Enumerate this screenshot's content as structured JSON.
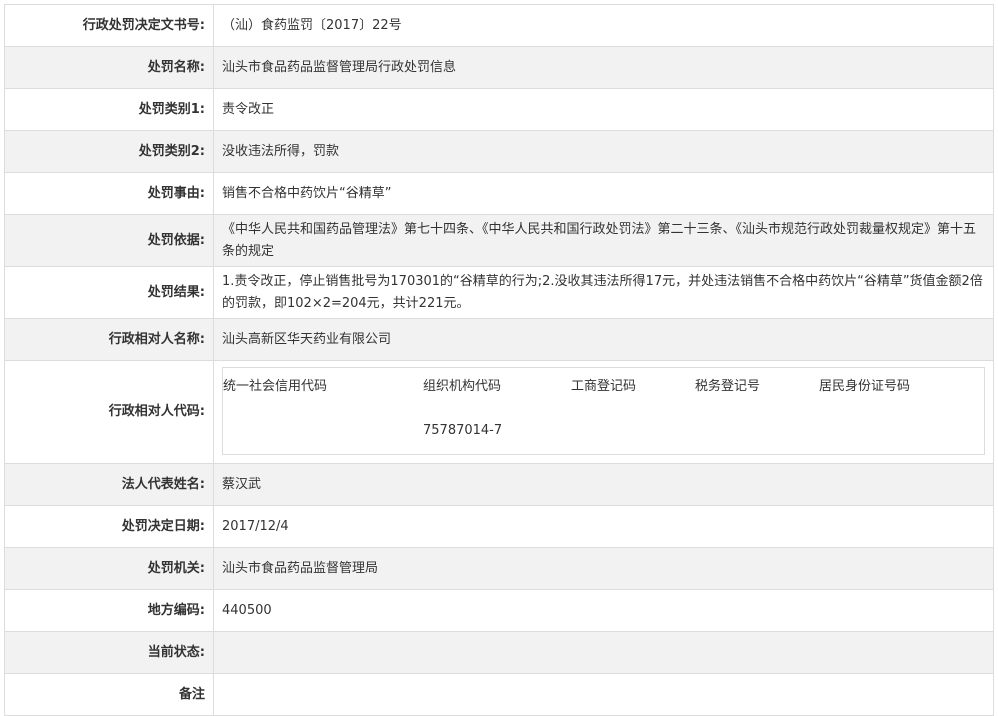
{
  "rows": [
    {
      "label": "行政处罚决定文书号:",
      "value": "（汕）食药监罚〔2017〕22号"
    },
    {
      "label": "处罚名称:",
      "value": "汕头市食品药品监督管理局行政处罚信息"
    },
    {
      "label": "处罚类别1:",
      "value": "责令改正"
    },
    {
      "label": "处罚类别2:",
      "value": "没收违法所得，罚款"
    },
    {
      "label": "处罚事由:",
      "value": "销售不合格中药饮片“谷精草”"
    },
    {
      "label": "处罚依据:",
      "value": "《中华人民共和国药品管理法》第七十四条、《中华人民共和国行政处罚法》第二十三条、《汕头市规范行政处罚裁量权规定》第十五条的规定"
    },
    {
      "label": "处罚结果:",
      "value": "1.责令改正，停止销售批号为170301的“谷精草的行为;2.没收其违法所得17元，并处违法销售不合格中药饮片“谷精草”货值金额2倍的罚款，即102×2=204元，共计221元。"
    },
    {
      "label": "行政相对人名称:",
      "value": "汕头高新区华天药业有限公司"
    }
  ],
  "code_row": {
    "label": "行政相对人代码:",
    "headers": [
      "统一社会信用代码",
      "组织机构代码",
      "工商登记码",
      "税务登记号",
      "居民身份证号码"
    ],
    "values": [
      "",
      "75787014-7",
      "",
      "",
      ""
    ]
  },
  "rows2": [
    {
      "label": "法人代表姓名:",
      "value": "蔡汉武"
    },
    {
      "label": "处罚决定日期:",
      "value": "2017/12/4"
    },
    {
      "label": "处罚机关:",
      "value": "汕头市食品药品监督管理局"
    },
    {
      "label": "地方编码:",
      "value": "440500"
    },
    {
      "label": "当前状态:",
      "value": ""
    },
    {
      "label": "备注",
      "value": ""
    }
  ]
}
